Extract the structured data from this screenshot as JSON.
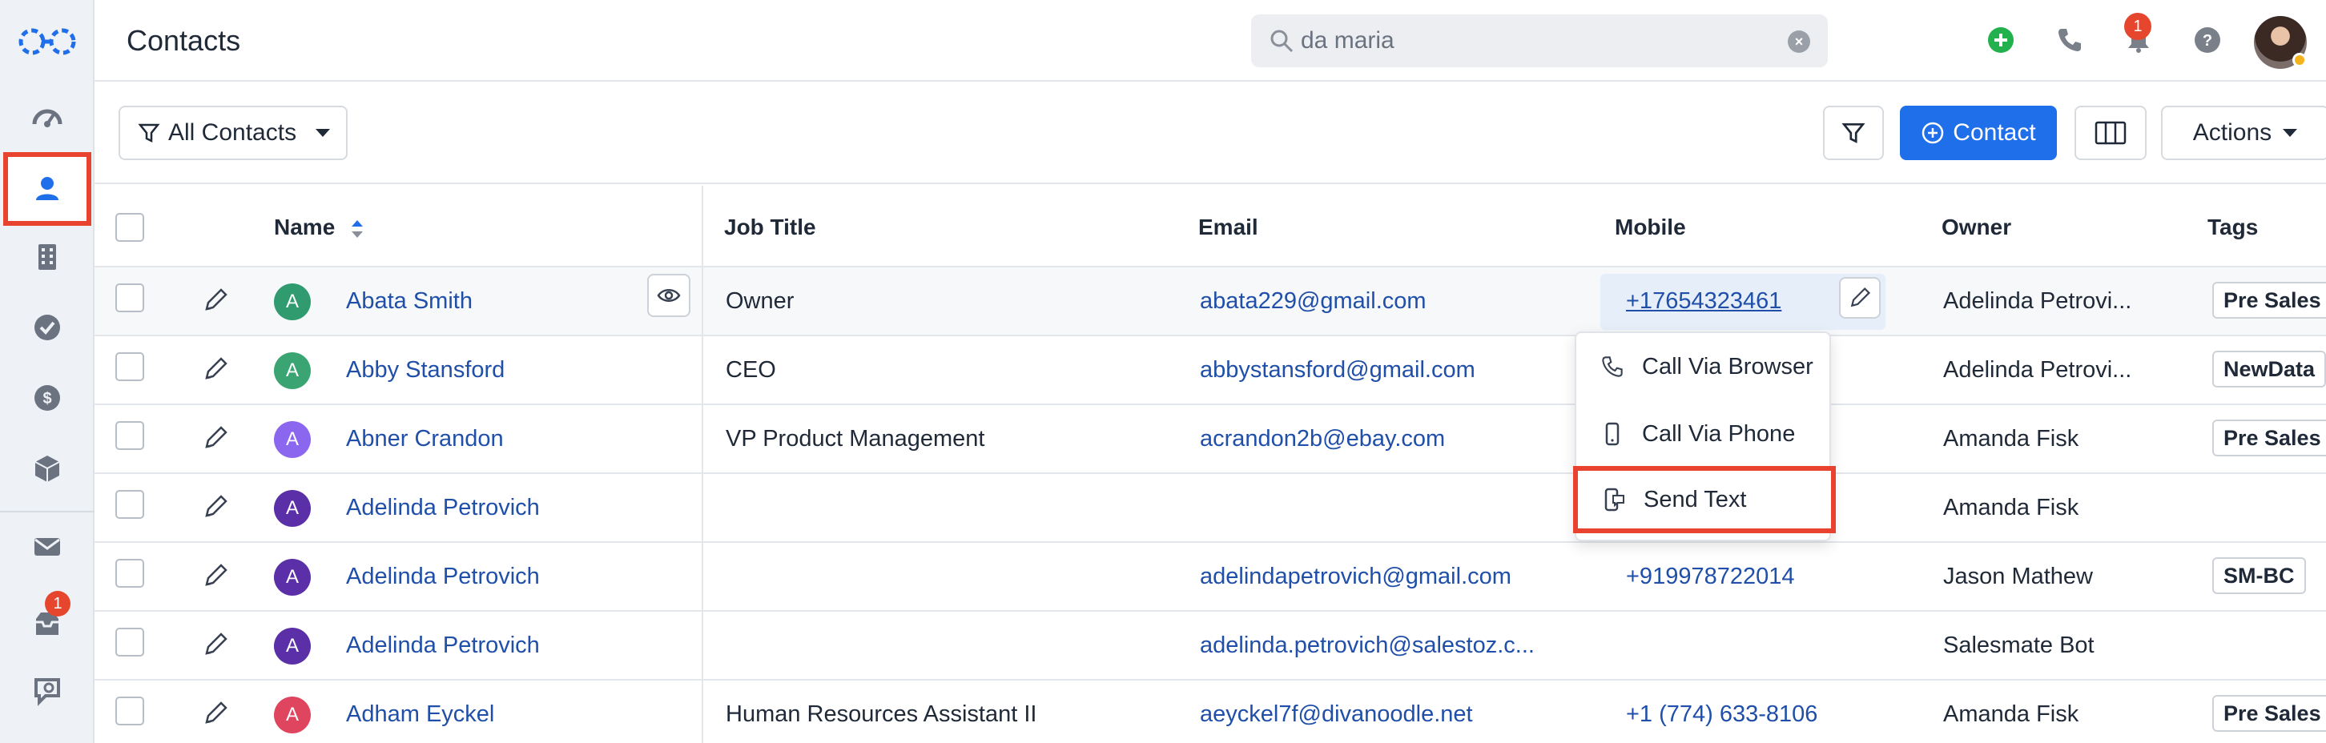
{
  "app": {
    "page_title": "Contacts"
  },
  "search": {
    "value": "da maria",
    "placeholder": "Search",
    "clear_label": "×"
  },
  "topbar": {
    "notification_count": "1"
  },
  "sidebar": {
    "inbox_badge": "1",
    "items": [
      {
        "icon": "dashboard-icon"
      },
      {
        "icon": "contacts-icon",
        "active": true
      },
      {
        "icon": "companies-icon"
      },
      {
        "icon": "tasks-icon"
      },
      {
        "icon": "deals-icon"
      },
      {
        "icon": "products-icon"
      },
      {
        "icon": "email-icon"
      },
      {
        "icon": "inbox-icon"
      },
      {
        "icon": "chat-icon"
      }
    ]
  },
  "toolbar": {
    "view_label": "All Contacts",
    "add_contact_label": "Contact",
    "actions_label": "Actions"
  },
  "table": {
    "columns": [
      "Name",
      "Job Title",
      "Email",
      "Mobile",
      "Owner",
      "Tags"
    ],
    "rows": [
      {
        "initial": "A",
        "avatar_color": "#2f9b6e",
        "name": "Abata Smith",
        "job_title": "Owner",
        "email": "abata229@gmail.com",
        "mobile": "+17654323461",
        "owner": "Adelinda Petrovi...",
        "tag": "Pre Sales"
      },
      {
        "initial": "A",
        "avatar_color": "#3aa572",
        "name": "Abby Stansford",
        "job_title": "CEO",
        "email": "abbystansford@gmail.com",
        "mobile": "",
        "owner": "Adelinda Petrovi...",
        "tag": "NewData"
      },
      {
        "initial": "A",
        "avatar_color": "#8b67f0",
        "name": "Abner Crandon",
        "job_title": "VP Product Management",
        "email": "acrandon2b@ebay.com",
        "mobile": "",
        "owner": "Amanda Fisk",
        "tag": "Pre Sales"
      },
      {
        "initial": "A",
        "avatar_color": "#5b2fa8",
        "name": "Adelinda Petrovich",
        "job_title": "",
        "email": "",
        "mobile": "",
        "owner": "Amanda Fisk",
        "tag": ""
      },
      {
        "initial": "A",
        "avatar_color": "#5b2fa8",
        "name": "Adelinda Petrovich",
        "job_title": "",
        "email": "adelindapetrovich@gmail.com",
        "mobile": "+919978722014",
        "owner": "Jason Mathew",
        "tag": "SM-BC"
      },
      {
        "initial": "A",
        "avatar_color": "#5b2fa8",
        "name": "Adelinda Petrovich",
        "job_title": "",
        "email": "adelinda.petrovich@salestoz.c...",
        "mobile": "",
        "owner": "Salesmate Bot",
        "tag": ""
      },
      {
        "initial": "A",
        "avatar_color": "#e0455f",
        "name": "Adham Eyckel",
        "job_title": "Human Resources Assistant II",
        "email": "aeyckel7f@divanoodle.net",
        "mobile": "+1 (774) 633-8106",
        "owner": "Amanda Fisk",
        "tag": "Pre Sales"
      }
    ]
  },
  "call_menu": {
    "items": [
      "Call Via Browser",
      "Call Via Phone",
      "Send Text"
    ]
  },
  "colors": {
    "accent": "#1f6feb",
    "highlight": "#e8432e",
    "link": "#1f4fa8"
  }
}
